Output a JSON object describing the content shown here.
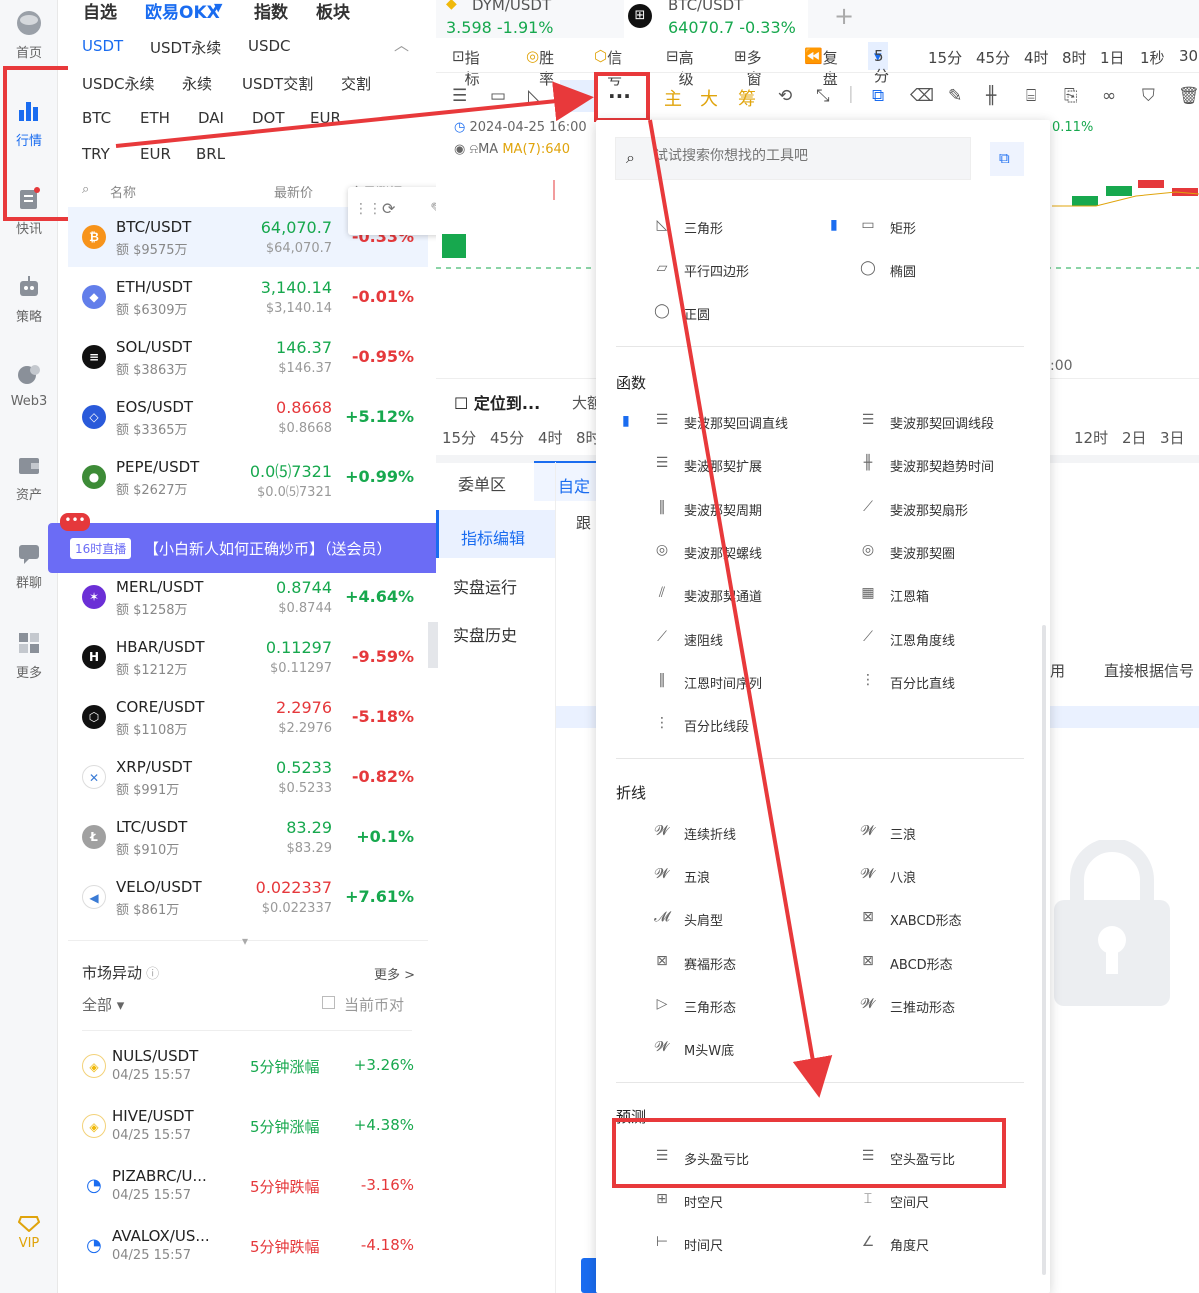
{
  "nav": {
    "items": [
      {
        "label": "首页"
      },
      {
        "label": "行情"
      },
      {
        "label": "快讯"
      },
      {
        "label": "策略"
      },
      {
        "label": "Web3"
      },
      {
        "label": "资产"
      },
      {
        "label": "群聊"
      },
      {
        "label": "更多"
      },
      {
        "label": "VIP"
      }
    ]
  },
  "market": {
    "top_tabs": [
      "自选",
      "欧易OKX",
      "指数",
      "板块"
    ],
    "quote_tabs": [
      "USDT",
      "USDT永续",
      "USDC"
    ],
    "sub_tabs1": [
      "USDC永续",
      "永续",
      "USDT交割",
      "交割"
    ],
    "sub_tabs2": [
      "BTC",
      "ETH",
      "DAI",
      "DOT",
      "EUR"
    ],
    "sub_tabs3": [
      "TRY",
      "EUR",
      "BRL"
    ],
    "col_headers": {
      "name": "名称",
      "price": "最新价",
      "change": "今日涨幅"
    },
    "coins": [
      {
        "name": "BTC/USDT",
        "vol": "额 $9575万",
        "price": "64,070.7",
        "sub": "$64,070.7",
        "chg": "-0.33%",
        "dir": "up",
        "chgdir": "down",
        "color": "#f7931a",
        "sym": "₿"
      },
      {
        "name": "ETH/USDT",
        "vol": "额 $6309万",
        "price": "3,140.14",
        "sub": "$3,140.14",
        "chg": "-0.01%",
        "dir": "up",
        "chgdir": "down",
        "color": "#627eea",
        "sym": "◆"
      },
      {
        "name": "SOL/USDT",
        "vol": "额 $3863万",
        "price": "146.37",
        "sub": "$146.37",
        "chg": "-0.95%",
        "dir": "up",
        "chgdir": "down",
        "color": "#111",
        "sym": "≡"
      },
      {
        "name": "EOS/USDT",
        "vol": "额 $3365万",
        "price": "0.8668",
        "sub": "$0.8668",
        "chg": "+5.12%",
        "dir": "down",
        "chgdir": "up",
        "color": "#2a5ada",
        "sym": "◇"
      },
      {
        "name": "PEPE/USDT",
        "vol": "额 $2627万",
        "price": "0.0⑸7321",
        "sub": "$0.0⑸7321",
        "chg": "+0.99%",
        "dir": "up",
        "chgdir": "up",
        "color": "#3d8b37",
        "sym": "●"
      },
      {
        "name": "MERL/USDT",
        "vol": "额 $1258万",
        "price": "0.8744",
        "sub": "$0.8744",
        "chg": "+4.64%",
        "dir": "up",
        "chgdir": "up",
        "color": "#6b2fd6",
        "sym": "✶"
      },
      {
        "name": "HBAR/USDT",
        "vol": "额 $1212万",
        "price": "0.11297",
        "sub": "$0.11297",
        "chg": "-9.59%",
        "dir": "up",
        "chgdir": "down",
        "color": "#111",
        "sym": "H"
      },
      {
        "name": "CORE/USDT",
        "vol": "额 $1108万",
        "price": "2.2976",
        "sub": "$2.2976",
        "chg": "-5.18%",
        "dir": "down",
        "chgdir": "down",
        "color": "#111",
        "sym": "⬡"
      },
      {
        "name": "XRP/USDT",
        "vol": "额 $991万",
        "price": "0.5233",
        "sub": "$0.5233",
        "chg": "-0.82%",
        "dir": "up",
        "chgdir": "down",
        "color": "#fff",
        "sym": "✕"
      },
      {
        "name": "LTC/USDT",
        "vol": "额 $910万",
        "price": "83.29",
        "sub": "$83.29",
        "chg": "+0.1%",
        "dir": "up",
        "chgdir": "up",
        "color": "#a0a0a0",
        "sym": "Ł"
      },
      {
        "name": "VELO/USDT",
        "vol": "额 $861万",
        "price": "0.022337",
        "sub": "$0.022337",
        "chg": "+7.61%",
        "dir": "down",
        "chgdir": "up",
        "color": "#fff",
        "sym": "◀"
      }
    ],
    "live_banner": {
      "tag": "16时直播",
      "text": "【小白新人如何正确炒币】（送会员）"
    },
    "anomaly": {
      "title": "市场异动",
      "more": "更多 >",
      "filter": "全部",
      "current": "当前币对",
      "items": [
        {
          "name": "NULS/USDT",
          "time": "04/25 15:57",
          "label": "5分钟涨幅",
          "chg": "+3.26%",
          "dir": "up"
        },
        {
          "name": "HIVE/USDT",
          "time": "04/25 15:57",
          "label": "5分钟涨幅",
          "chg": "+4.38%",
          "dir": "up"
        },
        {
          "name": "PIZABRC/U...",
          "time": "04/25 15:57",
          "label": "5分钟跌幅",
          "chg": "-3.16%",
          "dir": "down"
        },
        {
          "name": "AVALOX/US...",
          "time": "04/25 15:57",
          "label": "5分钟跌幅",
          "chg": "-4.18%",
          "dir": "down"
        }
      ]
    }
  },
  "chart": {
    "tabs": [
      {
        "name": "DYM/USDT",
        "price": "3.598",
        "chg": "-1.91%"
      },
      {
        "name": "BTC/USDT",
        "price": "64070.7",
        "chg": "-0.33%"
      }
    ],
    "toolbar": [
      "指标",
      "胜率",
      "信号",
      "高级",
      "多窗",
      "复盘",
      "5分",
      "15分",
      "45分",
      "4时",
      "8时",
      "1日",
      "1秒",
      "30"
    ],
    "draw_text": [
      "主",
      "大",
      "筹"
    ],
    "date": "2024-04-25 16:00",
    "ma": "MA",
    "ma7": "MA(7):640",
    "pct": "0.11%",
    "time_label": ":00",
    "locate": "定位到...",
    "big": "大额",
    "period_row": [
      "15分",
      "45分",
      "4时",
      "8时"
    ],
    "period_right": [
      "12时",
      "2日",
      "3日"
    ],
    "side_tabs": [
      "委单区",
      "自定"
    ],
    "side_menu": [
      "指标编辑",
      "实盘运行",
      "实盘历史"
    ],
    "follow": "跟",
    "right_text": [
      "用",
      "直接根据信号"
    ]
  },
  "popup": {
    "search_placeholder": "试试搜索你想找的工具吧",
    "shapes": [
      "三角形",
      "矩形",
      "平行四边形",
      "椭圆",
      "正圆"
    ],
    "func_title": "函数",
    "funcs": [
      "斐波那契回调直线",
      "斐波那契回调线段",
      "斐波那契扩展",
      "斐波那契趋势时间",
      "斐波那契周期",
      "斐波那契扇形",
      "斐波那契螺线",
      "斐波那契圈",
      "斐波那契通道",
      "江恩箱",
      "速阻线",
      "江恩角度线",
      "江恩时间序列",
      "百分比直线",
      "百分比线段"
    ],
    "poly_title": "折线",
    "polys": [
      "连续折线",
      "三浪",
      "五浪",
      "八浪",
      "头肩型",
      "XABCD形态",
      "赛福形态",
      "ABCD形态",
      "三角形态",
      "三推动形态",
      "M头W底"
    ],
    "predict_title": "预测",
    "predicts": [
      "多头盈亏比",
      "空头盈亏比",
      "时空尺",
      "空间尺",
      "时间尺",
      "角度尺"
    ]
  }
}
